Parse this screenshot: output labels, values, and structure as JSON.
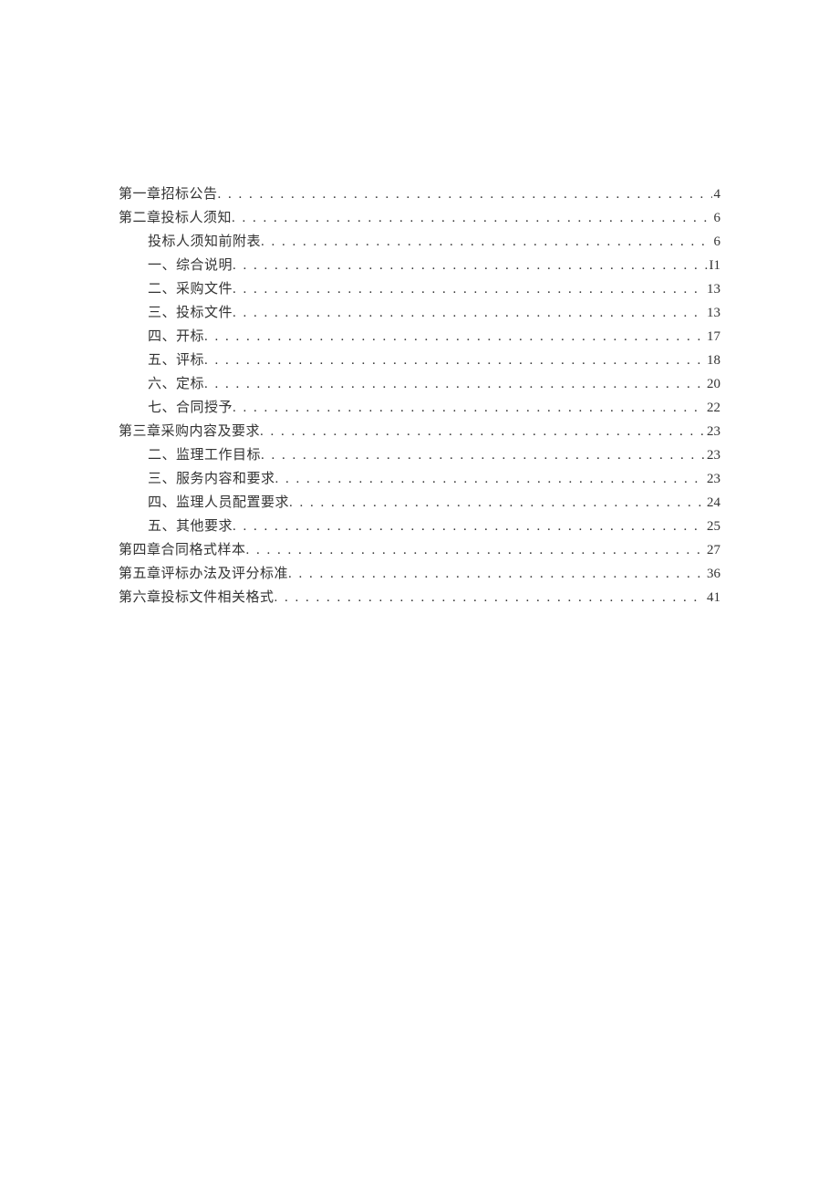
{
  "toc": [
    {
      "level": 0,
      "label": "第一章招标公告",
      "page": "4"
    },
    {
      "level": 0,
      "label": "第二章投标人须知",
      "page": "6"
    },
    {
      "level": 1,
      "label": "投标人须知前附表",
      "page": "6"
    },
    {
      "level": 1,
      "label": "一、综合说明",
      "page": "I1"
    },
    {
      "level": 1,
      "label": "二、采购文件",
      "page": "13"
    },
    {
      "level": 1,
      "label": "三、投标文件",
      "page": "13"
    },
    {
      "level": 1,
      "label": "四、开标",
      "page": "17"
    },
    {
      "level": 1,
      "label": "五、评标",
      "page": "18"
    },
    {
      "level": 1,
      "label": "六、定标",
      "page": "20"
    },
    {
      "level": 1,
      "label": "七、合同授予",
      "page": "22"
    },
    {
      "level": 0,
      "label": "第三章采购内容及要求",
      "page": "23"
    },
    {
      "level": 1,
      "label": "二、监理工作目标",
      "page": "23"
    },
    {
      "level": 1,
      "label": "三、服务内容和要求",
      "page": "23"
    },
    {
      "level": 1,
      "label": "四、监理人员配置要求",
      "page": "24"
    },
    {
      "level": 1,
      "label": "五、其他要求",
      "page": "25"
    },
    {
      "level": 0,
      "label": "第四章合同格式样本",
      "page": "27"
    },
    {
      "level": 0,
      "label": "第五章评标办法及评分标准",
      "page": "36"
    },
    {
      "level": 0,
      "label": "第六章投标文件相关格式",
      "page": "41"
    }
  ]
}
